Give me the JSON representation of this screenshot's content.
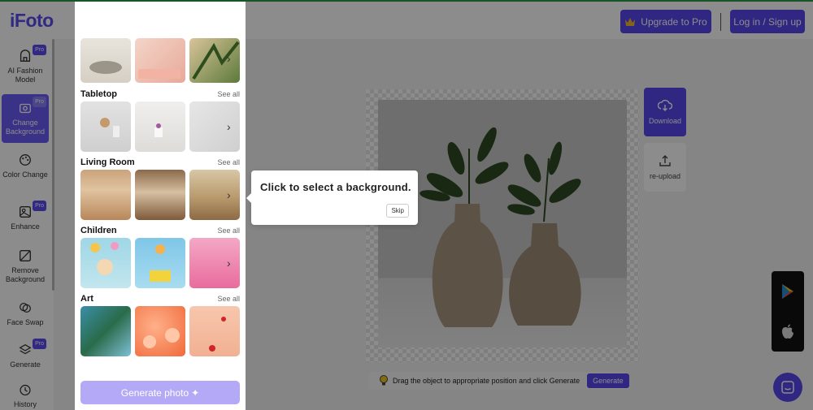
{
  "header": {
    "logo": "iFoto",
    "upgrade_label": "Upgrade to Pro",
    "login_label": "Log in / Sign up"
  },
  "sidebar": {
    "pro_badge": "Pro",
    "items": [
      {
        "label": "AI Fashion Model",
        "icon": "hanger-icon",
        "pro": true
      },
      {
        "label": "Change Background",
        "icon": "photo-frame-icon",
        "pro": true,
        "active": true
      },
      {
        "label": "Color Change",
        "icon": "palette-icon",
        "pro": false
      },
      {
        "label": "Enhance",
        "icon": "enhance-icon",
        "pro": true
      },
      {
        "label": "Remove Background",
        "icon": "eraser-icon",
        "pro": false
      },
      {
        "label": "Face Swap",
        "icon": "face-swap-icon",
        "pro": false
      },
      {
        "label": "Generate",
        "icon": "layers-icon",
        "pro": true
      },
      {
        "label": "History",
        "icon": "clock-icon",
        "pro": false
      }
    ]
  },
  "panel": {
    "see_all": "See all",
    "categories": [
      {
        "title": "Tabletop"
      },
      {
        "title": "Living Room"
      },
      {
        "title": "Children"
      },
      {
        "title": "Art"
      }
    ],
    "generate_label": "Generate photo"
  },
  "tools": {
    "download_label": "Download",
    "reupload_label": "re-upload"
  },
  "hint": {
    "text": "Drag the object to appropriate position and click Generate",
    "button_label": "Generate"
  },
  "tooltip": {
    "text": "Click to select a background.",
    "skip_label": "Skip"
  },
  "colors": {
    "accent": "#5848ee",
    "accent_light": "#b3a9f7"
  }
}
